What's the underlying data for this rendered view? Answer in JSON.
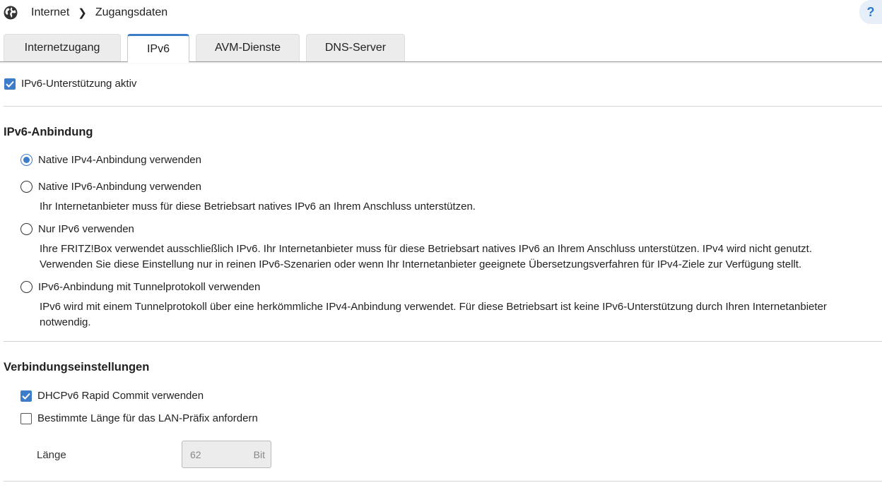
{
  "breadcrumb": {
    "icon": "globe-icon",
    "root": "Internet",
    "current": "Zugangsdaten"
  },
  "help_label": "?",
  "tabs": [
    {
      "label": "Internetzugang",
      "active": false
    },
    {
      "label": "IPv6",
      "active": true
    },
    {
      "label": "AVM-Dienste",
      "active": false
    },
    {
      "label": "DNS-Server",
      "active": false
    }
  ],
  "ipv6_support": {
    "label": "IPv6-Unterstützung aktiv",
    "checked": true
  },
  "anbindung": {
    "heading": "IPv6-Anbindung",
    "options": [
      {
        "label": "Native IPv4-Anbindung verwenden",
        "checked": true,
        "desc": ""
      },
      {
        "label": "Native IPv6-Anbindung verwenden",
        "checked": false,
        "desc": "Ihr Internetanbieter muss für diese Betriebsart natives IPv6 an Ihrem Anschluss unterstützen."
      },
      {
        "label": "Nur IPv6 verwenden",
        "checked": false,
        "desc_line1": "Ihre FRITZ!Box verwendet ausschließlich IPv6. Ihr Internetanbieter muss für diese Betriebsart natives IPv6 an Ihrem Anschluss unterstützen. IPv4 wird nicht genutzt.",
        "desc_line2": "Verwenden Sie diese Einstellung nur in reinen IPv6-Szenarien oder wenn Ihr Internetanbieter geeignete Übersetzungsverfahren für IPv4-Ziele zur Verfügung stellt."
      },
      {
        "label": "IPv6-Anbindung mit Tunnelprotokoll verwenden",
        "checked": false,
        "desc_line1": "IPv6 wird mit einem Tunnelprotokoll über eine herkömmliche IPv4-Anbindung verwendet. Für diese Betriebsart ist keine IPv6-Unterstützung durch Ihren Internetanbieter",
        "desc_line2": "notwendig."
      }
    ]
  },
  "verbindung": {
    "heading": "Verbindungseinstellungen",
    "rapid_commit": {
      "label": "DHCPv6 Rapid Commit verwenden",
      "checked": true
    },
    "lan_prefix": {
      "label": "Bestimmte Länge für das LAN-Präfix anfordern",
      "checked": false
    },
    "laenge": {
      "label": "Länge",
      "value": "62",
      "unit": "Bit"
    }
  },
  "colors": {
    "accent": "#3d7cc9"
  }
}
